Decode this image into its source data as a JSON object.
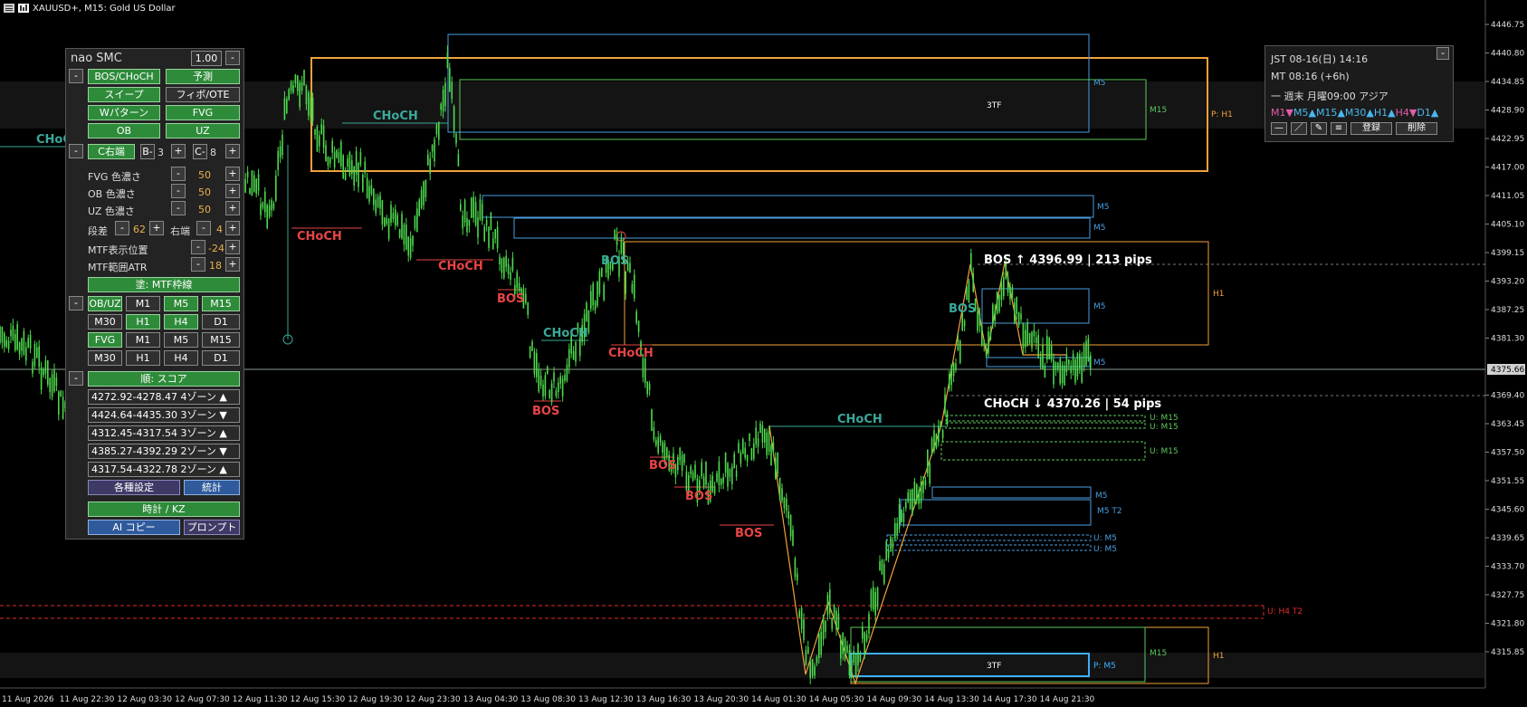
{
  "window": {
    "title": "XAUUSD+, M15:  Gold US Dollar"
  },
  "price_axis": {
    "labels": [
      "4446.75",
      "4440.80",
      "4434.85",
      "4428.90",
      "4422.95",
      "4417.00",
      "4411.05",
      "4405.10",
      "4399.15",
      "4393.20",
      "4387.25",
      "4381.30",
      "4375.66",
      "4369.40",
      "4363.45",
      "4357.50",
      "4351.55",
      "4345.60",
      "4339.65",
      "4333.70",
      "4327.75",
      "4321.80",
      "4315.85"
    ],
    "current": "4375.66"
  },
  "time_axis": {
    "labels": [
      "11 Aug 2026",
      "11 Aug 22:30",
      "12 Aug 03:30",
      "12 Aug 07:30",
      "12 Aug 11:30",
      "12 Aug 15:30",
      "12 Aug 19:30",
      "12 Aug 23:30",
      "13 Aug 04:30",
      "13 Aug 08:30",
      "13 Aug 12:30",
      "13 Aug 16:30",
      "13 Aug 20:30",
      "14 Aug 01:30",
      "14 Aug 05:30",
      "14 Aug 09:30",
      "14 Aug 13:30",
      "14 Aug 17:30",
      "14 Aug 21:30"
    ]
  },
  "annotations": {
    "choch_left": "CHoCH",
    "choch1": "CHoCH",
    "choch2": "CHoCH",
    "choch3": "CHoCH",
    "choch4": "CHoCH",
    "choch5": "CHoCH",
    "choch6": "CHoCH",
    "bos1": "BOS",
    "bos2": "BOS",
    "bos3": "BOS",
    "bos4": "BOS",
    "bos5": "BOS",
    "bos6": "BOS",
    "bos7": "BOS",
    "bos_high": "BOS ↑  4396.99  |  213 pips",
    "choch_low": "CHoCH ↓  4370.26  |  54 pips",
    "tf3_top": "3TF",
    "tf3_bottom": "3TF",
    "m5_1": "M5",
    "m5_2": "M5",
    "m5_3": "M5",
    "m5_4": "M5",
    "m5_5": "M5",
    "m5_6": "M5",
    "m15_top": "M15",
    "m15_bottom": "M15",
    "ph1": "P: H1",
    "h1_right": "H1",
    "h1_bottom": "H1",
    "m5t2": "M5 T2",
    "um15_1": "U: M15",
    "um15_2": "U: M15",
    "um15_3": "U: M15",
    "um5_1": "U: M5",
    "um5_2": "U: M5",
    "uh4t2": "U: H4 T2",
    "pm5": "P: M5"
  },
  "panel": {
    "title": "nao SMC",
    "version": "1.00",
    "btn_bos": "BOS/CHoCH",
    "btn_yosoku": "予測",
    "btn_sweep": "スイープ",
    "btn_fibo": "フィボ/OTE",
    "btn_w": "Wパターン",
    "btn_fvg": "FVG",
    "btn_ob": "OB",
    "btn_uz": "UZ",
    "c_right": "C右端",
    "b_minus": "B-",
    "b_val": "3",
    "c_minus": "C-",
    "c_val": "8",
    "fvg_label": "FVG 色濃さ",
    "fvg_val": "50",
    "ob_label": "OB 色濃さ",
    "ob_val": "50",
    "uz_label": "UZ 色濃さ",
    "uz_val": "50",
    "dansa_label": "段差",
    "dansa_val": "62",
    "migi_label": "右端",
    "migi_val": "4",
    "mtf_pos_label": "MTF表示位置",
    "mtf_pos_val": "-24",
    "mtf_atr_label": "MTF範囲ATR",
    "mtf_atr_val": "18",
    "mtf_frame": "塗: MTF枠線",
    "obuz": "OB/UZ",
    "m1a": "M1",
    "m5a": "M5",
    "m15a": "M15",
    "m30a": "M30",
    "h1a": "H1",
    "h4a": "H4",
    "d1a": "D1",
    "fvg": "FVG",
    "m1b": "M1",
    "m5b": "M5",
    "m15b": "M15",
    "m30b": "M30",
    "h1b": "H1",
    "h4b": "H4",
    "d1b": "D1",
    "score": "順: スコア",
    "zones": [
      {
        "text": "4272.92-4278.47  4ゾーン ▲"
      },
      {
        "text": "4424.64-4435.30  3ゾーン ▼"
      },
      {
        "text": "4312.45-4317.54  3ゾーン ▲"
      },
      {
        "text": "4385.27-4392.29  2ゾーン ▼"
      },
      {
        "text": "4317.54-4322.78  2ゾーン ▲"
      }
    ],
    "settings": "各種設定",
    "stats": "統計",
    "clock": "時計 / KZ",
    "ai_copy": "AI コピー",
    "prompt": "プロンプト"
  },
  "info": {
    "jst": "JST 08-16(日) 14:16",
    "mt": "MT 08:16 (+6h)",
    "weekend": "一 週末 月曜09:00 アジア",
    "tf": [
      {
        "t": "M1",
        "d": "▼",
        "c": "#e05ca8"
      },
      {
        "t": "M5",
        "d": "▲",
        "c": "#4ab8f0"
      },
      {
        "t": "M15",
        "d": "▲",
        "c": "#4ab8f0"
      },
      {
        "t": "M30",
        "d": "▲",
        "c": "#4ab8f0"
      },
      {
        "t": "H1",
        "d": "▲",
        "c": "#4ab8f0"
      },
      {
        "t": "H4",
        "d": "▼",
        "c": "#e05ca8"
      },
      {
        "t": "D1",
        "d": "▲",
        "c": "#4ab8f0"
      }
    ],
    "register": "登録",
    "delete": "削除"
  },
  "colors": {
    "candle": "#4cd94c",
    "bull_box": "#4a9ee0",
    "bear_box": "#f2a23a",
    "bos_red": "#e84545",
    "choch_teal": "#3aa89a",
    "m15_green": "#5cc85c"
  }
}
